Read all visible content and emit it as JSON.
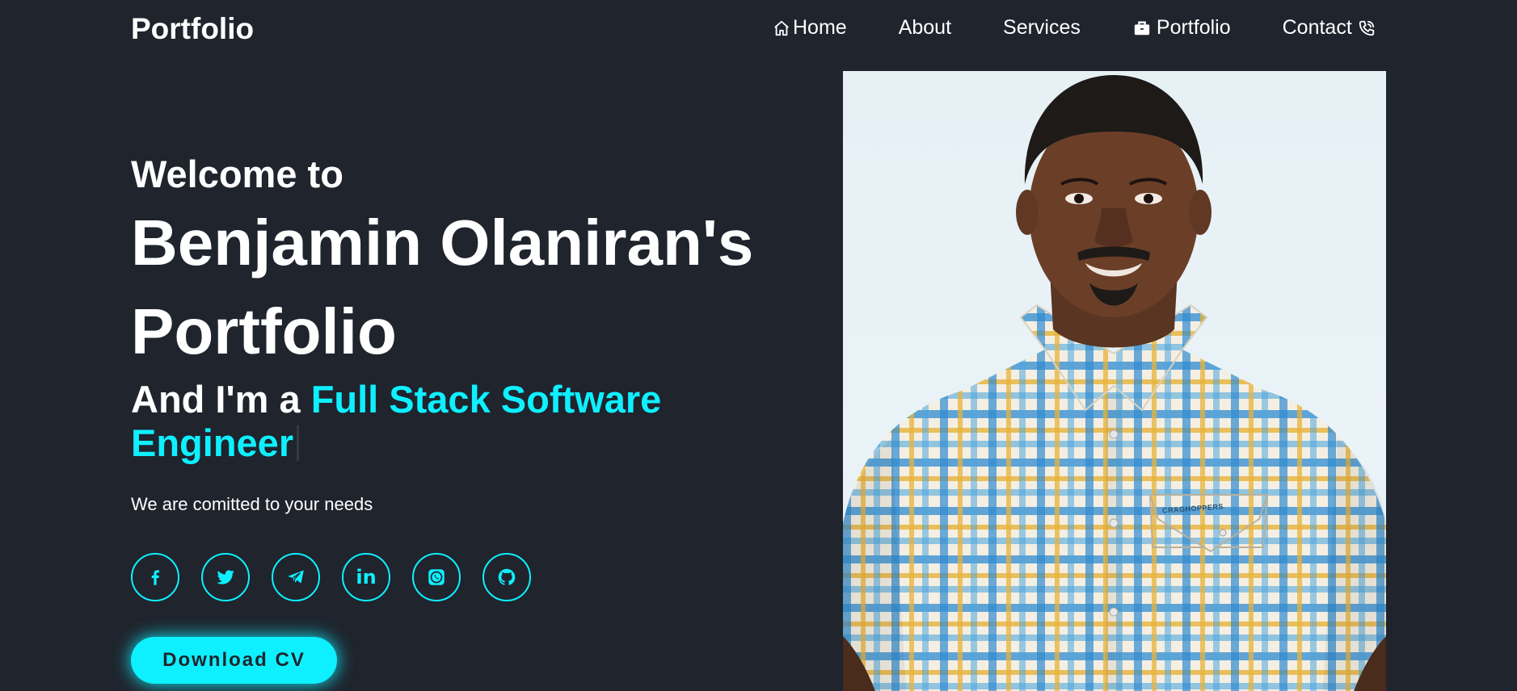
{
  "header": {
    "logo": "Portfolio",
    "nav": [
      {
        "label": "Home",
        "icon": "home-icon"
      },
      {
        "label": "About"
      },
      {
        "label": "Services"
      },
      {
        "label": "Portfolio",
        "icon": "briefcase-icon"
      },
      {
        "label": "Contact",
        "icon": "phone-icon"
      }
    ]
  },
  "hero": {
    "welcome": "Welcome to",
    "name": "Benjamin Olaniran's Portfolio",
    "role_prefix": "And I'm a ",
    "role": "Full Stack Software Engineer",
    "tagline": "We are comitted to your needs",
    "socials": [
      {
        "name": "facebook-icon"
      },
      {
        "name": "twitter-icon"
      },
      {
        "name": "telegram-icon"
      },
      {
        "name": "linkedin-icon",
        "text": "in"
      },
      {
        "name": "whatsapp-icon"
      },
      {
        "name": "github-icon"
      }
    ],
    "cta": "Download CV"
  },
  "photo": {
    "shirt_label": "CRAGHOPPERS"
  },
  "colors": {
    "background": "#1f242d",
    "accent": "#0ef0ff",
    "text": "#ffffff"
  }
}
